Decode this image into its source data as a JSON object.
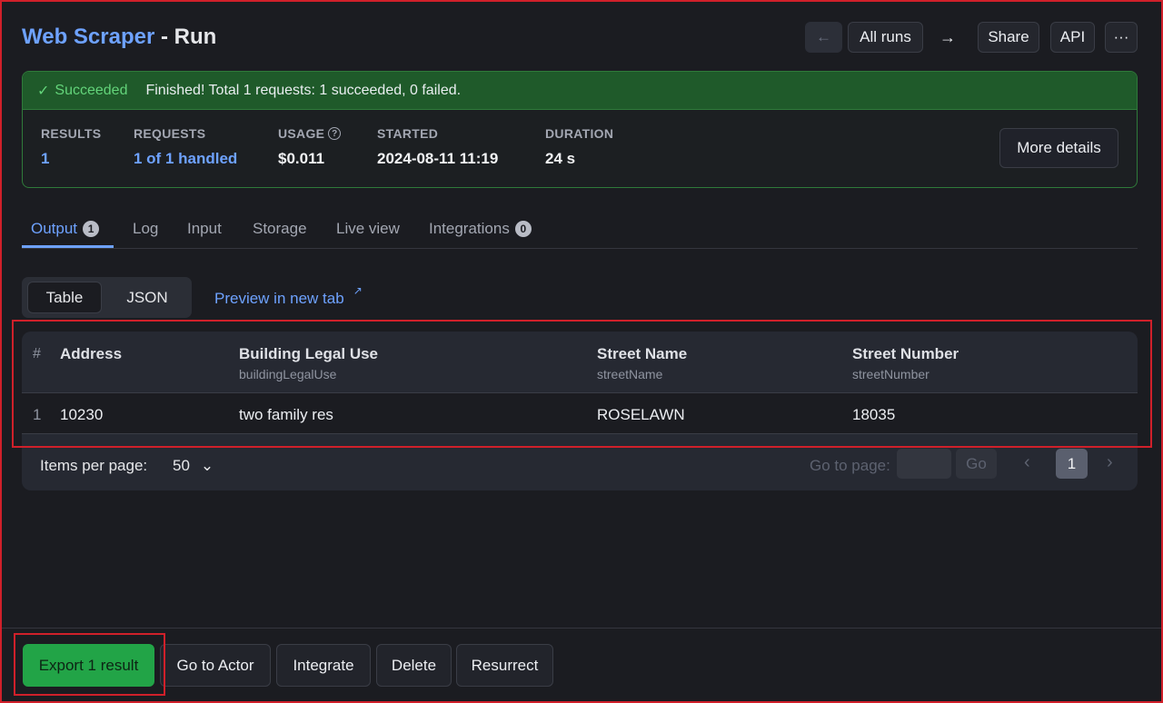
{
  "header": {
    "actor_name": "Web Scraper",
    "separator": " - ",
    "page_name": "Run",
    "back_icon": "arrow-left-icon",
    "all_runs_label": "All runs",
    "forward_icon": "arrow-right-icon",
    "share_label": "Share",
    "api_label": "API",
    "more_label": "···"
  },
  "status": {
    "state_label": "Succeeded",
    "message": "Finished! Total 1 requests: 1 succeeded, 0 failed.",
    "stats": {
      "results": {
        "label": "RESULTS",
        "value": "1"
      },
      "requests": {
        "label": "REQUESTS",
        "value": "1 of 1 handled"
      },
      "usage": {
        "label": "USAGE",
        "value": "$0.011"
      },
      "started": {
        "label": "STARTED",
        "value": "2024-08-11 11:19"
      },
      "duration": {
        "label": "DURATION",
        "value": "24 s"
      }
    },
    "more_details_label": "More details",
    "colors": {
      "success_bg": "#1f5a2a",
      "success_text": "#63d47a"
    }
  },
  "tabs": [
    {
      "label": "Output",
      "badge": "1",
      "active": true
    },
    {
      "label": "Log"
    },
    {
      "label": "Input"
    },
    {
      "label": "Storage"
    },
    {
      "label": "Live view"
    },
    {
      "label": "Integrations",
      "badge": "0"
    }
  ],
  "view_toggle": {
    "table_label": "Table",
    "json_label": "JSON",
    "selected": "Table"
  },
  "preview_link": {
    "label": "Preview in new tab",
    "icon": "external-link-icon"
  },
  "table": {
    "index_header": "#",
    "columns": [
      {
        "title": "Address",
        "field": ""
      },
      {
        "title": "Building Legal Use",
        "field": "buildingLegalUse"
      },
      {
        "title": "Street Name",
        "field": "streetName"
      },
      {
        "title": "Street Number",
        "field": "streetNumber"
      }
    ],
    "rows": [
      {
        "index": "1",
        "cells": [
          "10230",
          "two family res",
          "ROSELAWN",
          "18035"
        ]
      }
    ]
  },
  "pagination": {
    "items_per_page_label": "Items per page:",
    "items_per_page_value": "50",
    "go_to_page_label": "Go to page:",
    "go_label": "Go",
    "current_page": "1"
  },
  "footer": {
    "export_label": "Export 1 result",
    "go_to_actor_label": "Go to Actor",
    "integrate_label": "Integrate",
    "delete_label": "Delete",
    "resurrect_label": "Resurrect"
  },
  "accent_color": "#6ea2ff",
  "annotation_color": "#d0202a"
}
